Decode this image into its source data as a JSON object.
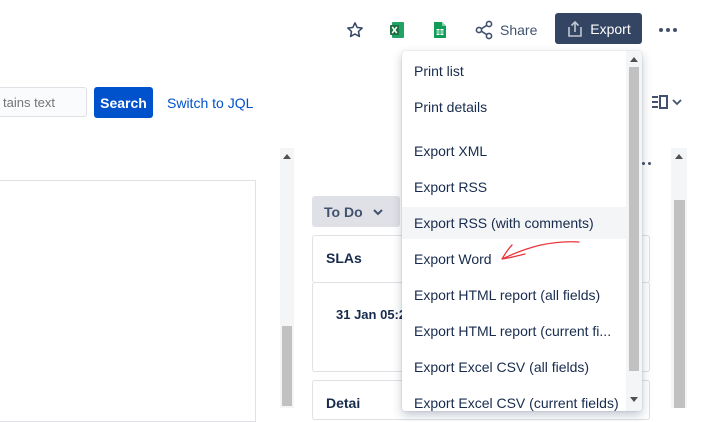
{
  "toolbar": {
    "share_label": "Share",
    "export_label": "Export",
    "icons": [
      "star-icon",
      "excel-icon",
      "sheets-icon",
      "share-icon",
      "export-icon",
      "more-icon"
    ]
  },
  "search": {
    "placeholder": "tains text",
    "button_label": "Search",
    "switch_link": "Switch to JQL"
  },
  "issue": {
    "status_label": "To Do",
    "sla_title": "SLAs",
    "sla_date": "31 Jan 05:2",
    "details_title": "Detai"
  },
  "export_menu": {
    "items": [
      {
        "label": "Print list"
      },
      {
        "label": "Print details"
      },
      {
        "label": "Export XML"
      },
      {
        "label": "Export RSS"
      },
      {
        "label": "Export RSS (with comments)",
        "hovered": true
      },
      {
        "label": "Export Word"
      },
      {
        "label": "Export HTML report (all fields)"
      },
      {
        "label": "Export HTML report (current fi..."
      },
      {
        "label": "Export Excel CSV (all fields)"
      },
      {
        "label": "Export Excel CSV (current fields)"
      }
    ]
  },
  "annotation": {
    "color": "#e8363b"
  },
  "colors": {
    "primary": "#0052cc",
    "export_button": "#344563",
    "text": "#172b4d",
    "excel_green": "#1d6f42",
    "sheets_green": "#0f9d58"
  }
}
